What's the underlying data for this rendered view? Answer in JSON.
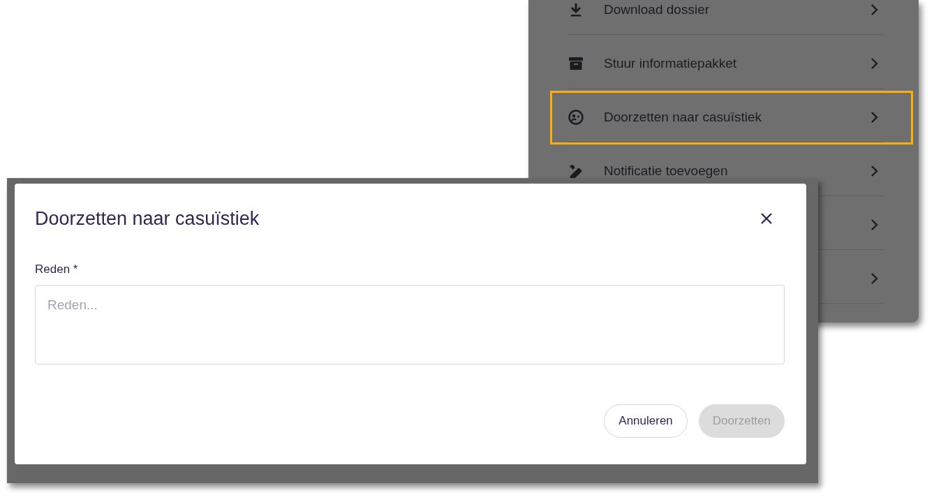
{
  "menu": {
    "items": [
      {
        "label": "Download dossier",
        "highlighted": false
      },
      {
        "label": "Stuur informatiepakket",
        "highlighted": false
      },
      {
        "label": "Doorzetten naar casuïstiek",
        "highlighted": true
      },
      {
        "label": "Notificatie toevoegen",
        "highlighted": false
      },
      {
        "highlighted": false
      },
      {
        "highlighted": false
      }
    ]
  },
  "dialog": {
    "title": "Doorzetten naar casuïstiek",
    "field": {
      "label": "Reden *",
      "placeholder": "Reden..."
    },
    "buttons": [
      {
        "label": "Annuleren",
        "kind": "secondary",
        "disabled": false
      },
      {
        "label": "Doorzetten",
        "kind": "primary",
        "disabled": true
      }
    ]
  }
}
